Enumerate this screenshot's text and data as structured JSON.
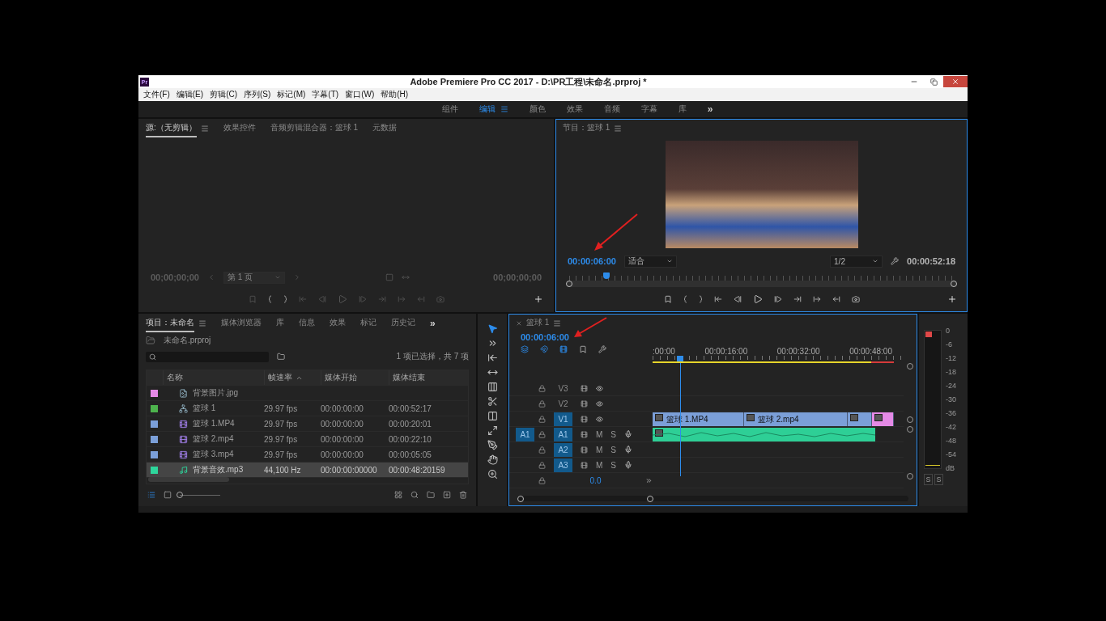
{
  "window": {
    "app_icon": "Pr",
    "title": "Adobe Premiere Pro CC 2017 - D:\\PR工程\\未命名.prproj *"
  },
  "menu": [
    "文件(F)",
    "编辑(E)",
    "剪辑(C)",
    "序列(S)",
    "标记(M)",
    "字幕(T)",
    "窗口(W)",
    "帮助(H)"
  ],
  "workspaces": [
    {
      "label": "组件",
      "selected": false
    },
    {
      "label": "编辑",
      "selected": true
    },
    {
      "label": "颜色",
      "selected": false
    },
    {
      "label": "效果",
      "selected": false
    },
    {
      "label": "音频",
      "selected": false
    },
    {
      "label": "字幕",
      "selected": false
    },
    {
      "label": "库",
      "selected": false
    }
  ],
  "workspaces_more": "»",
  "source_panel": {
    "tabs": [
      {
        "label": "源:（无剪辑）",
        "selected": true
      },
      {
        "label": "效果控件",
        "selected": false
      },
      {
        "label": "音频剪辑混合器：篮球 1",
        "selected": false
      },
      {
        "label": "元数据",
        "selected": false
      }
    ],
    "timecode_in": "00;00;00;00",
    "page": "第 1 页",
    "timecode_out": "00;00;00;00"
  },
  "program_panel": {
    "tab": "节目：篮球 1",
    "timecode": "00:00:06:00",
    "zoom": "适合",
    "resolution": "1/2",
    "duration": "00:00:52:18",
    "playhead": {
      "level": 0.104
    }
  },
  "project_panel": {
    "tabs": [
      {
        "label": "项目：未命名",
        "selected": true
      },
      {
        "label": "媒体浏览器",
        "selected": false
      },
      {
        "label": "库",
        "selected": false
      },
      {
        "label": "信息",
        "selected": false
      },
      {
        "label": "效果",
        "selected": false
      },
      {
        "label": "标记",
        "selected": false
      },
      {
        "label": "历史记",
        "selected": false
      }
    ],
    "more": "»",
    "project_file": "未命名.prproj",
    "zoom_slider": {
      "level": 0
    },
    "selection_info": "1 项已选择，共 7 项",
    "columns": [
      "名称",
      "帧速率",
      "媒体开始",
      "媒体结束"
    ],
    "rows": [
      {
        "color": "#e58ae6",
        "kind": "image",
        "name": "背景图片.jpg",
        "selected": false
      },
      {
        "color": "#4db34d",
        "kind": "sequence",
        "name": "篮球 1",
        "frame_rate": "29.97 fps",
        "start": "00:00:00:00",
        "end": "00:00:52:17",
        "selected": false
      },
      {
        "color": "#7b9fd8",
        "kind": "video",
        "name": "篮球 1.MP4",
        "frame_rate": "29.97 fps",
        "start": "00:00:00:00",
        "end": "00:00:20:01",
        "selected": false
      },
      {
        "color": "#7b9fd8",
        "kind": "video",
        "name": "篮球 2.mp4",
        "frame_rate": "29.97 fps",
        "start": "00:00:00:00",
        "end": "00:00:22:10",
        "selected": false
      },
      {
        "color": "#7b9fd8",
        "kind": "video",
        "name": "篮球 3.mp4",
        "frame_rate": "29.97 fps",
        "start": "00:00:00:00",
        "end": "00:00:05:05",
        "selected": false
      },
      {
        "color": "#2ed69c",
        "kind": "audio",
        "name": "背景音效.mp3",
        "frame_rate": "44,100 Hz",
        "start": "00:00:00:00000",
        "end": "00:00:48:20159",
        "selected": true
      }
    ]
  },
  "tools": [
    {
      "kind": "selection",
      "selected": true
    },
    {
      "kind": "track-select",
      "selected": false
    },
    {
      "kind": "ripple",
      "selected": false
    },
    {
      "kind": "rolling",
      "selected": false
    },
    {
      "kind": "rate",
      "selected": false
    },
    {
      "kind": "razor",
      "selected": false
    },
    {
      "kind": "slip",
      "selected": false
    },
    {
      "kind": "slide",
      "selected": false
    },
    {
      "kind": "pen",
      "selected": false
    },
    {
      "kind": "hand",
      "selected": false
    },
    {
      "kind": "zoom",
      "selected": false
    }
  ],
  "timeline": {
    "tab": "篮球 1",
    "timecode": "00:00:06:00",
    "ruler": [
      ":00:00",
      "00:00:16:00",
      "00:00:32:00",
      "00:00:48:00"
    ],
    "playhead": {
      "level": 0.11
    },
    "video_tracks": [
      {
        "name": "V3",
        "targeted": false
      },
      {
        "name": "V2",
        "targeted": false
      },
      {
        "name": "V1",
        "targeted": true,
        "clips": [
          {
            "label": "篮球 1.MP4",
            "color": "#7b9fd8"
          },
          {
            "label": "篮球 2.mp4",
            "color": "#7b9fd8"
          },
          {
            "color": "#7b9fd8"
          },
          {
            "color": "#e58ae6"
          }
        ]
      }
    ],
    "audio_tracks": [
      {
        "source": "A1",
        "name": "A1",
        "targeted": true,
        "mute": "M",
        "solo": "S",
        "clips": [
          {
            "color": "#2ecf96"
          }
        ]
      },
      {
        "name": "A2",
        "targeted": true,
        "mute": "M",
        "solo": "S"
      },
      {
        "name": "A3",
        "targeted": true,
        "mute": "M",
        "solo": "S"
      }
    ],
    "master": "0.0"
  },
  "meter": {
    "scale": [
      "0",
      "-6",
      "-12",
      "-18",
      "-24",
      "-30",
      "-36",
      "-42",
      "-48",
      "-54",
      "dB"
    ],
    "solo": [
      "S",
      "S"
    ]
  }
}
